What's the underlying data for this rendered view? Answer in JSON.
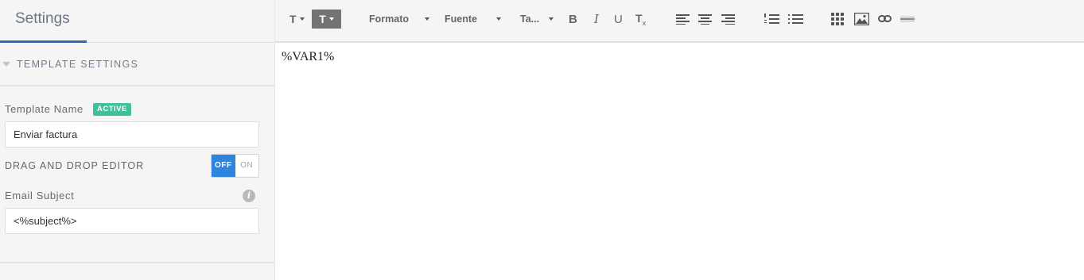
{
  "sidebar": {
    "title": "Settings",
    "section": {
      "label": "TEMPLATE SETTINGS"
    },
    "template_name": {
      "label": "Template Name",
      "badge": "ACTIVE",
      "value": "Enviar factura"
    },
    "drag_drop": {
      "label": "DRAG AND DROP EDITOR",
      "off_label": "OFF",
      "on_label": "ON",
      "state": "OFF"
    },
    "email_subject": {
      "label": "Email Subject",
      "value": "<%subject%>",
      "info_icon": "i"
    }
  },
  "toolbar": {
    "text_color": {
      "glyph": "T",
      "icon": "text-color-icon"
    },
    "bg_color": {
      "glyph": "T",
      "icon": "background-color-icon"
    },
    "format_label": "Formato",
    "font_label": "Fuente",
    "size_label": "Ta...",
    "bold": "B",
    "italic": "I",
    "underline": "U",
    "clear_format": {
      "glyph": "T",
      "sub": "x"
    },
    "icons": [
      "align-left-icon",
      "align-center-icon",
      "align-right-icon",
      "ordered-list-icon",
      "unordered-list-icon",
      "table-icon",
      "image-icon",
      "link-icon",
      "horizontal-rule-icon"
    ]
  },
  "editor": {
    "content": "%VAR1%"
  },
  "colors": {
    "accent": "#2a6fb4",
    "toggle_active": "#2d85e0",
    "badge": "#3fc29b",
    "toolbar_active": "#737373"
  }
}
